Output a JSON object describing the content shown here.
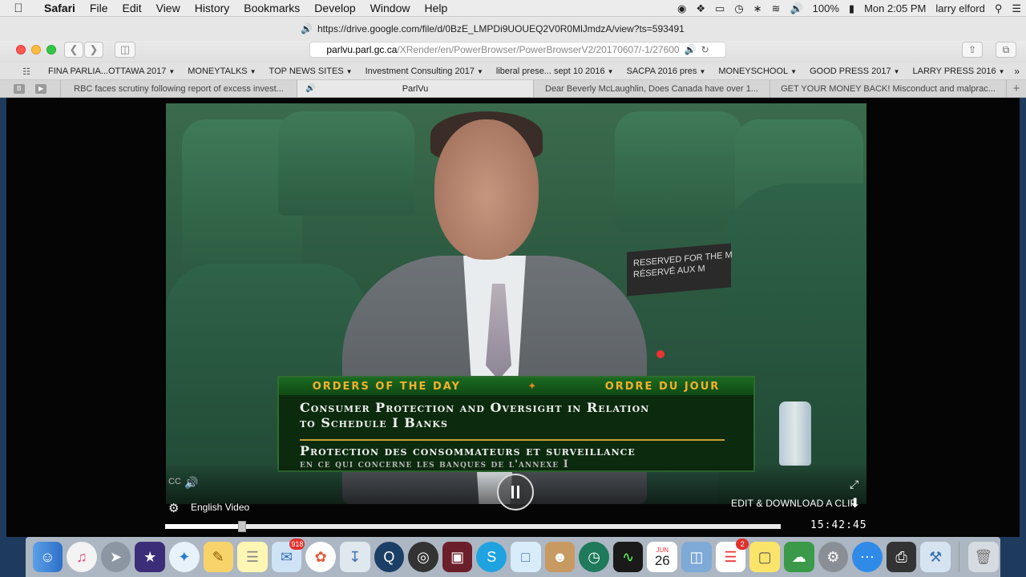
{
  "menubar": {
    "app": "Safari",
    "menus": [
      "File",
      "Edit",
      "View",
      "History",
      "Bookmarks",
      "Develop",
      "Window",
      "Help"
    ],
    "battery": "100%",
    "clock": "Mon 2:05 PM",
    "user": "larry elford"
  },
  "background_window": {
    "url": "https://drive.google.com/file/d/0BzE_LMPDi9UOUEQ2V0R0MlJmdzA/view?ts=593491"
  },
  "toolbar": {
    "url_host": "parlvu.parl.gc.ca",
    "url_path": "/XRender/en/PowerBrowser/PowerBrowserV2/20170607/-1/27600"
  },
  "bookmarks": [
    {
      "label": "FINA PARLIA...OTTAWA 2017"
    },
    {
      "label": "MONEYTALKS"
    },
    {
      "label": "TOP NEWS SITES"
    },
    {
      "label": "Investment Consulting 2017"
    },
    {
      "label": "liberal prese... sept 10 2016"
    },
    {
      "label": "SACPA 2016 pres"
    },
    {
      "label": "MONEYSCHOOL"
    },
    {
      "label": "GOOD PRESS 2017"
    },
    {
      "label": "LARRY PRESS 2016"
    }
  ],
  "tabs": [
    {
      "label": "RBC faces scrutiny following report of excess invest..."
    },
    {
      "label": "ParlVu"
    },
    {
      "label": "Dear Beverly McLaughlin, Does Canada have over 1..."
    },
    {
      "label": "GET YOUR MONEY BACK! Misconduct and malprac..."
    }
  ],
  "video": {
    "nameplate": "RESERVED FOR THE M\nRÉSERVÉ AUX M",
    "caption": {
      "left_header": "ORDERS OF THE DAY",
      "right_header": "ORDRE DU JOUR",
      "line1": "Consumer Protection and Oversight in Relation",
      "line2": "to Schedule I Banks",
      "line3": "Protection des consommateurs et surveillance",
      "line4": "en ce qui concerne les banques de l'annexe I"
    }
  },
  "player": {
    "cc_label": "CC",
    "language": "English Video",
    "edit_clip": "EDIT & DOWNLOAD A CLIP",
    "timecode": "15:42:45",
    "progress_fraction": 0.125
  },
  "dock": {
    "mail_badge": "918",
    "reminders_badge": "2",
    "calendar_day": "26",
    "calendar_month": "JUN"
  }
}
